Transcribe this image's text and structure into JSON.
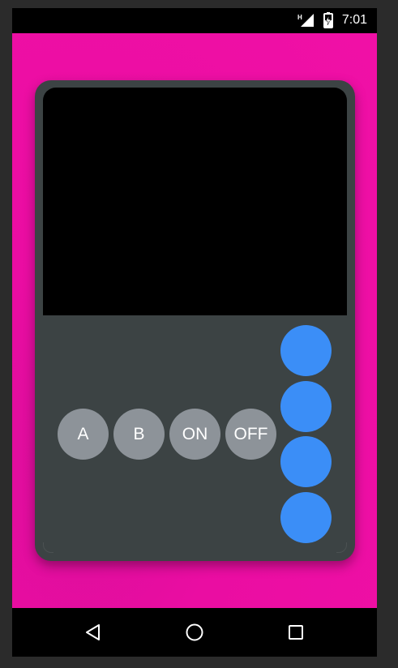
{
  "status_bar": {
    "time": "7:01",
    "network_type": "H",
    "icons": [
      "signal-icon",
      "battery-charging-icon"
    ]
  },
  "background_color": "#f010a6",
  "device": {
    "body_color": "#3c4344",
    "screen_color": "#000000",
    "buttons": [
      {
        "label": "A"
      },
      {
        "label": "B"
      },
      {
        "label": "ON"
      },
      {
        "label": "OFF"
      }
    ],
    "button_color": "#8d9399",
    "dpad_color": "#3b8ef7",
    "dpad_buttons": [
      "dpad-button-1",
      "dpad-button-2",
      "dpad-button-3",
      "dpad-button-4"
    ]
  },
  "nav_bar": {
    "icons": [
      "back-icon",
      "home-icon",
      "recents-icon"
    ]
  }
}
